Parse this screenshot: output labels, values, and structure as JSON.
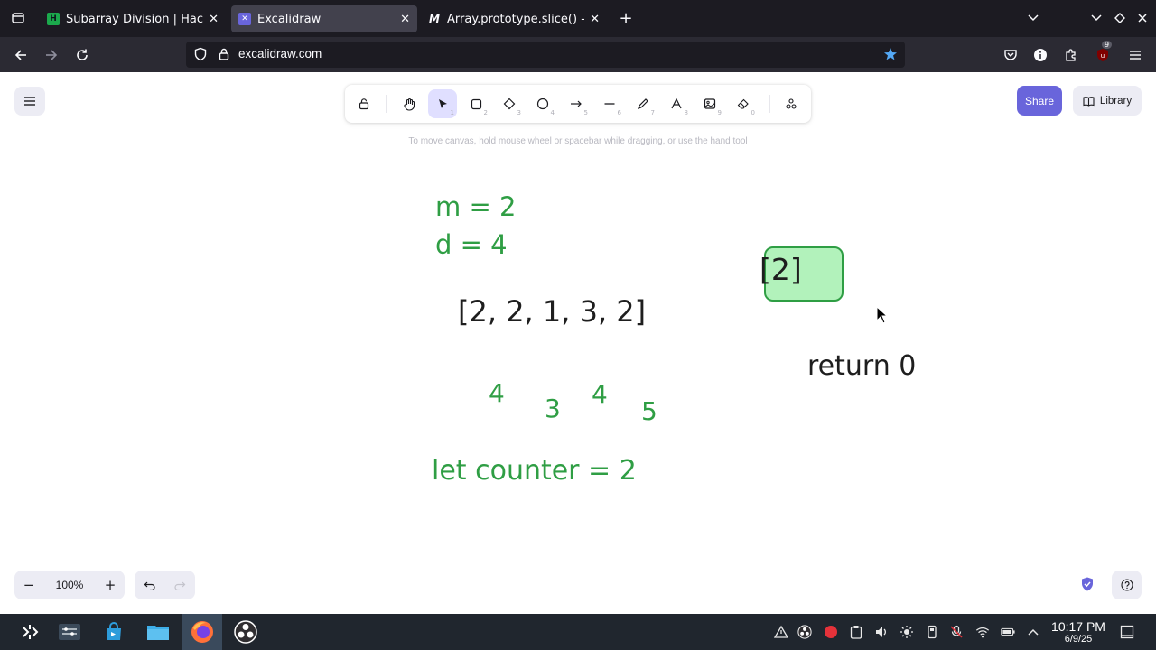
{
  "browser": {
    "tabs": [
      {
        "title": "Subarray Division | Hacker",
        "favicon": "hackerrank-icon",
        "active": false
      },
      {
        "title": "Excalidraw",
        "favicon": "excalidraw-icon",
        "active": true
      },
      {
        "title": "Array.prototype.slice() - Jav",
        "favicon": "mdn-icon",
        "active": false
      }
    ],
    "url": "excalidraw.com",
    "extension_badge": "9"
  },
  "excalidraw": {
    "hint": "To move canvas, hold mouse wheel or spacebar while dragging, or use the hand tool",
    "share_label": "Share",
    "library_label": "Library",
    "zoom": "100%",
    "tools": [
      {
        "name": "lock",
        "key": ""
      },
      {
        "name": "hand",
        "key": ""
      },
      {
        "name": "selection",
        "key": "1"
      },
      {
        "name": "rectangle",
        "key": "2"
      },
      {
        "name": "diamond",
        "key": "3"
      },
      {
        "name": "ellipse",
        "key": "4"
      },
      {
        "name": "arrow",
        "key": "5"
      },
      {
        "name": "line",
        "key": "6"
      },
      {
        "name": "draw",
        "key": "7"
      },
      {
        "name": "text",
        "key": "8"
      },
      {
        "name": "image",
        "key": "9"
      },
      {
        "name": "eraser",
        "key": "0"
      },
      {
        "name": "extra-tools",
        "key": ""
      }
    ],
    "canvas_text": {
      "m_eq": "m = 2",
      "d_eq": "d = 4",
      "array": "[2, 2, 1, 3, 2]",
      "sum1": "4",
      "sum2": "3",
      "sum3": "4",
      "sum4": "5",
      "counter": "let counter = 2",
      "box_label": "[2]",
      "return_text": "return 0"
    },
    "colors": {
      "green": "#2f9e44",
      "box_fill": "#b2f2bb",
      "accent": "#6965db"
    }
  },
  "taskbar": {
    "time": "10:17 PM",
    "date": "6/9/25"
  }
}
